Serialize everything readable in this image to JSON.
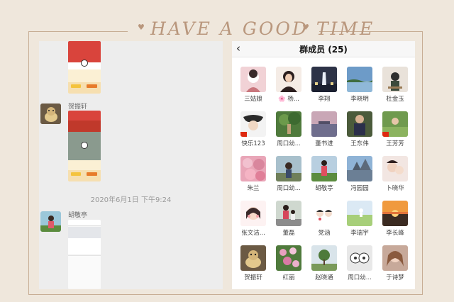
{
  "banner": "HAVE A GOOD TIME",
  "chat": {
    "messages": [
      {
        "sender": "贺振轩"
      },
      {
        "timestamp": "2020年6月1日 下午9:24"
      },
      {
        "sender": "胡敬亭"
      }
    ]
  },
  "group": {
    "title": "群成员 (25)",
    "members": [
      [
        "三姑娘",
        "🌸 杨...",
        "李翔",
        "李晓明",
        "杜金玉"
      ],
      [
        "快乐123",
        "周口幼...",
        "董书进",
        "王东伟",
        "王芳芳"
      ],
      [
        "朱兰",
        "周口幼...",
        "胡敬亭",
        "冯园园",
        "卜晓华"
      ],
      [
        "张文洁...",
        "董磊",
        "党涵",
        "李瑞宇",
        "李长峰"
      ],
      [
        "贺振轩",
        "红丽",
        "赵晓通",
        "周口幼...",
        "于诗梦"
      ]
    ]
  },
  "colors": {
    "accent": "#b9977d",
    "chat_bg": "#ededed",
    "poster_red": "#d9443c"
  }
}
